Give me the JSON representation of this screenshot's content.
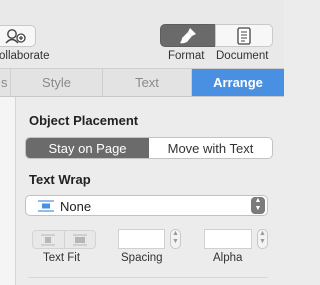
{
  "toolbar": {
    "collaborate_label": "ollaborate",
    "format_label": "Format",
    "document_label": "Document"
  },
  "tabs": [
    {
      "label": "s"
    },
    {
      "label": "Style"
    },
    {
      "label": "Text"
    },
    {
      "label": "Arrange",
      "active": true
    }
  ],
  "object_placement": {
    "heading": "Object Placement",
    "options": [
      "Stay on Page",
      "Move with Text"
    ],
    "selected": "Stay on Page"
  },
  "text_wrap": {
    "heading": "Text Wrap",
    "value": "None"
  },
  "controls": {
    "text_fit_label": "Text Fit",
    "spacing_label": "Spacing",
    "spacing_value": "",
    "alpha_label": "Alpha",
    "alpha_value": ""
  },
  "colors": {
    "accent": "#4a90e2",
    "segment_selected": "#6b6b6b"
  }
}
